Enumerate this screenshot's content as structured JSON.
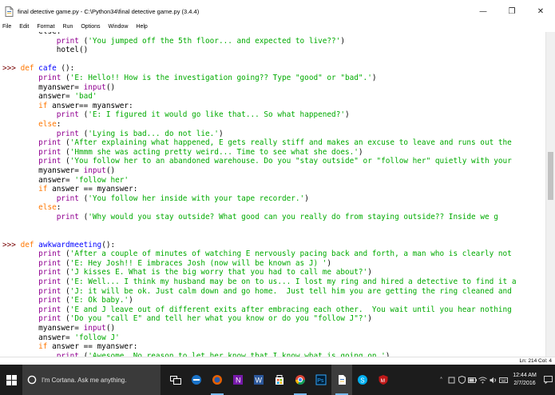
{
  "window": {
    "title": "final detective game.py - C:\\Python34\\final detective game.py (3.4.4)",
    "controls": {
      "minimize": "—",
      "maximize": "❐",
      "close": "✕"
    }
  },
  "menu": [
    "File",
    "Edit",
    "Format",
    "Run",
    "Options",
    "Window",
    "Help"
  ],
  "code_lines": [
    [
      [
        "",
        "        else:"
      ]
    ],
    [
      [
        "",
        "            "
      ],
      [
        "bi",
        "print"
      ],
      [
        "",
        " ("
      ],
      [
        "st",
        "'You jumped off the 5th floor... and expected to live??'"
      ],
      [
        "",
        ")"
      ]
    ],
    [
      [
        "",
        "            hotel()"
      ]
    ],
    [
      [
        "",
        ""
      ]
    ],
    [
      [
        "pr",
        ">>> "
      ],
      [
        "kw",
        "def"
      ],
      [
        "",
        " "
      ],
      [
        "df",
        "cafe"
      ],
      [
        "",
        " ():"
      ]
    ],
    [
      [
        "",
        "        "
      ],
      [
        "bi",
        "print"
      ],
      [
        "",
        " ("
      ],
      [
        "st",
        "'E: Hello!! How is the investigation going?? Type \"good\" or \"bad\".'"
      ],
      [
        "",
        ")"
      ]
    ],
    [
      [
        "",
        "        myanswer= "
      ],
      [
        "bi",
        "input"
      ],
      [
        "",
        "()"
      ]
    ],
    [
      [
        "",
        "        answer= "
      ],
      [
        "st",
        "'bad'"
      ]
    ],
    [
      [
        "",
        "        "
      ],
      [
        "kw",
        "if"
      ],
      [
        "",
        " answer== myanswer:"
      ]
    ],
    [
      [
        "",
        "            "
      ],
      [
        "bi",
        "print"
      ],
      [
        "",
        " ("
      ],
      [
        "st",
        "'E: I figured it would go like that... So what happened?'"
      ],
      [
        "",
        ")"
      ]
    ],
    [
      [
        "",
        "        "
      ],
      [
        "kw",
        "else"
      ],
      [
        "",
        ":"
      ]
    ],
    [
      [
        "",
        "            "
      ],
      [
        "bi",
        "print"
      ],
      [
        "",
        " ("
      ],
      [
        "st",
        "'Lying is bad... do not lie.'"
      ],
      [
        "",
        ")"
      ]
    ],
    [
      [
        "",
        "        "
      ],
      [
        "bi",
        "print"
      ],
      [
        "",
        " ("
      ],
      [
        "st",
        "'After explaining what happened, E gets really stiff and makes an excuse to leave and runs out the"
      ]
    ],
    [
      [
        "",
        "        "
      ],
      [
        "bi",
        "print"
      ],
      [
        "",
        " ("
      ],
      [
        "st",
        "'Hmmm she was acting pretty weird... Time to see what she does.'"
      ],
      [
        "",
        ")"
      ]
    ],
    [
      [
        "",
        "        "
      ],
      [
        "bi",
        "print"
      ],
      [
        "",
        " ("
      ],
      [
        "st",
        "'You follow her to an abandoned warehouse. Do you \"stay outside\" or \"follow her\" quietly with your"
      ]
    ],
    [
      [
        "",
        "        myanswer= "
      ],
      [
        "bi",
        "input"
      ],
      [
        "",
        "()"
      ]
    ],
    [
      [
        "",
        "        answer= "
      ],
      [
        "st",
        "'follow her'"
      ]
    ],
    [
      [
        "",
        "        "
      ],
      [
        "kw",
        "if"
      ],
      [
        "",
        " answer == myanswer:"
      ]
    ],
    [
      [
        "",
        "            "
      ],
      [
        "bi",
        "print"
      ],
      [
        "",
        " ("
      ],
      [
        "st",
        "'You follow her inside with your tape recorder.'"
      ],
      [
        "",
        ")"
      ]
    ],
    [
      [
        "",
        "        "
      ],
      [
        "kw",
        "else"
      ],
      [
        "",
        ":"
      ]
    ],
    [
      [
        "",
        "            "
      ],
      [
        "bi",
        "print"
      ],
      [
        "",
        " ("
      ],
      [
        "st",
        "'Why would you stay outside? What good can you really do from staying outside?? Inside we g"
      ]
    ],
    [
      [
        "",
        ""
      ]
    ],
    [
      [
        "",
        ""
      ]
    ],
    [
      [
        "pr",
        ">>> "
      ],
      [
        "kw",
        "def"
      ],
      [
        "",
        " "
      ],
      [
        "df",
        "awkwardmeeting"
      ],
      [
        "",
        "():"
      ]
    ],
    [
      [
        "",
        "        "
      ],
      [
        "bi",
        "print"
      ],
      [
        "",
        " ("
      ],
      [
        "st",
        "'After a couple of minutes of watching E nervously pacing back and forth, a man who is clearly not"
      ]
    ],
    [
      [
        "",
        "        "
      ],
      [
        "bi",
        "print"
      ],
      [
        "",
        " ("
      ],
      [
        "st",
        "'E: Hey Josh!! E imbraces Josh (now will be known as J) '"
      ],
      [
        "",
        ")"
      ]
    ],
    [
      [
        "",
        "        "
      ],
      [
        "bi",
        "print"
      ],
      [
        "",
        " ("
      ],
      [
        "st",
        "'J kisses E. What is the big worry that you had to call me about?'"
      ],
      [
        "",
        ")"
      ]
    ],
    [
      [
        "",
        "        "
      ],
      [
        "bi",
        "print"
      ],
      [
        "",
        " ("
      ],
      [
        "st",
        "'E: Well... I think my husband may be on to us... I lost my ring and hired a detective to find it a"
      ]
    ],
    [
      [
        "",
        "        "
      ],
      [
        "bi",
        "print"
      ],
      [
        "",
        " ("
      ],
      [
        "st",
        "'J: it will be ok. Just calm down and go home.  Just tell him you are getting the ring cleaned and"
      ]
    ],
    [
      [
        "",
        "        "
      ],
      [
        "bi",
        "print"
      ],
      [
        "",
        " ("
      ],
      [
        "st",
        "'E: Ok baby.'"
      ],
      [
        "",
        ")"
      ]
    ],
    [
      [
        "",
        "        "
      ],
      [
        "bi",
        "print"
      ],
      [
        "",
        " ("
      ],
      [
        "st",
        "'E and J leave out of different exits after embracing each other.  You wait until you hear nothing"
      ]
    ],
    [
      [
        "",
        "        "
      ],
      [
        "bi",
        "print"
      ],
      [
        "",
        " ("
      ],
      [
        "st",
        "'Do you \"call E\" and tell her what you know or do you \"follow J\"?'"
      ],
      [
        "",
        ")"
      ]
    ],
    [
      [
        "",
        "        myanswer= "
      ],
      [
        "bi",
        "input"
      ],
      [
        "",
        "()"
      ]
    ],
    [
      [
        "",
        "        answer= "
      ],
      [
        "st",
        "'follow J'"
      ]
    ],
    [
      [
        "",
        "        "
      ],
      [
        "kw",
        "if"
      ],
      [
        "",
        " answer == myanswer:"
      ]
    ],
    [
      [
        "",
        "            "
      ],
      [
        "bi",
        "print"
      ],
      [
        "",
        " ("
      ],
      [
        "st",
        "'Awesome. No reason to let her know that I know what is going on.'"
      ],
      [
        "",
        ")"
      ]
    ]
  ],
  "status": {
    "position": "Ln: 214   Col: 4"
  },
  "taskbar": {
    "cortana_placeholder": "I'm Cortana. Ask me anything.",
    "apps": [
      "task-view",
      "edge",
      "firefox",
      "onenote",
      "word",
      "store",
      "chrome",
      "photoshop",
      "idle",
      "skype",
      "mcafee"
    ],
    "clock_time": "12:44 AM",
    "clock_date": "2/7/2016"
  }
}
